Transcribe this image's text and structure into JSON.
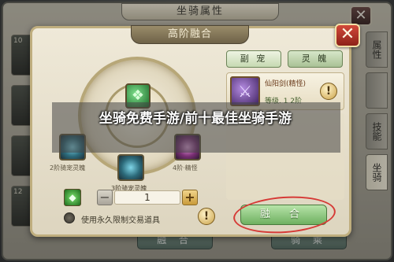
{
  "back_panel": {
    "title": "坐骑属性",
    "close_glyph": "✕",
    "left_slots": [
      "10",
      "",
      "",
      "12",
      "12"
    ],
    "right_tabs": [
      "属性",
      "",
      "技能",
      "坐骑"
    ],
    "bottom_buttons": [
      "融 合",
      "骑 乘"
    ]
  },
  "dialog": {
    "title": "高阶融合",
    "close_glyph": "✕",
    "center_icon": "green-beast-icon",
    "slots": {
      "left_label": "2阶骑宠灵魄",
      "right_label": "4阶·精怪",
      "bottom_label": "3阶骑宠灵魄"
    },
    "quantity": {
      "value": "1",
      "minus": "−",
      "plus": "+"
    },
    "use_option_label": "使用永久限制交易道具",
    "warning_glyph": "!",
    "tabs": [
      "副 宠",
      "灵 魄"
    ],
    "item_card": {
      "name": "仙阳剑(精怪)",
      "level": "等级. 1    2阶"
    },
    "fuse_button": "融 合"
  },
  "caption": "坐骑免费手游/前十最佳坐骑手游",
  "colors": {
    "accent_green": "#6eb060",
    "highlight_ring": "#d63a36",
    "close_red": "#d24a3a"
  }
}
